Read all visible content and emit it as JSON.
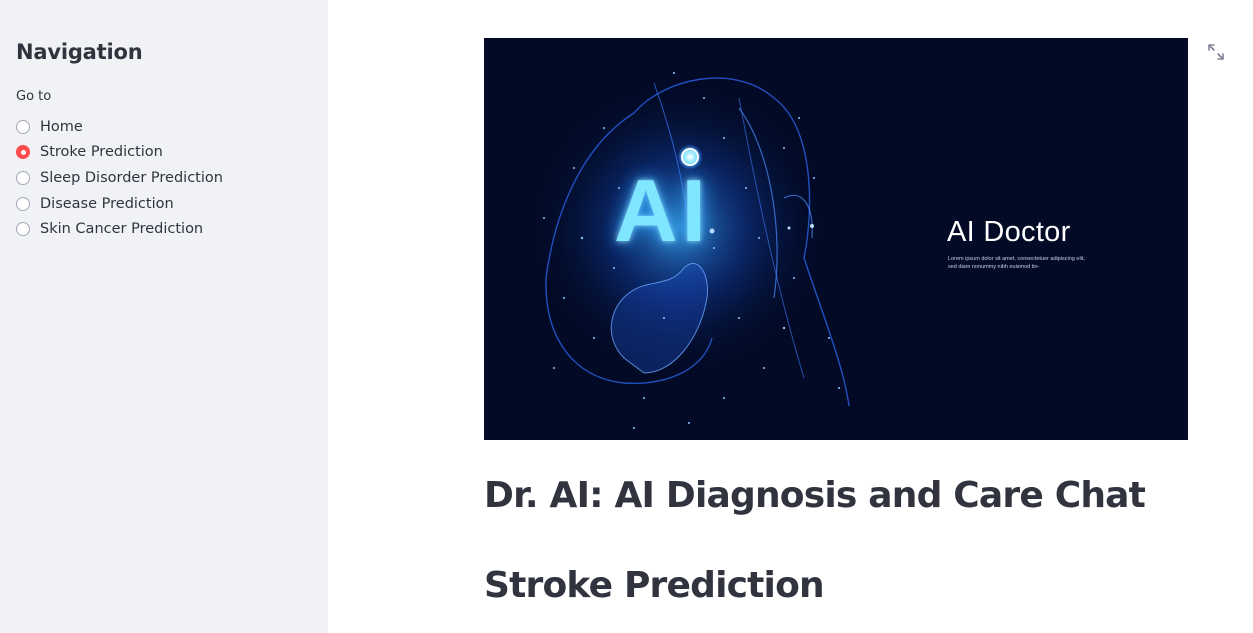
{
  "sidebar": {
    "title": "Navigation",
    "radio_label": "Go to",
    "options": [
      {
        "label": "Home",
        "selected": false
      },
      {
        "label": "Stroke Prediction",
        "selected": true
      },
      {
        "label": "Sleep Disorder Prediction",
        "selected": false
      },
      {
        "label": "Disease Prediction",
        "selected": false
      },
      {
        "label": "Skin Cancer Prediction",
        "selected": false
      }
    ]
  },
  "main": {
    "hero_image": {
      "big_text": "AI",
      "title": "AI Doctor",
      "subtitle": "Lorem ipsum dolor sit amet, consectetuer adipiscing elit, sed diam nonummy nibh euismod tin-"
    },
    "heading": "Dr. AI: AI Diagnosis and Care Chat",
    "subheading": "Stroke Prediction"
  },
  "colors": {
    "sidebar_bg": "#f0f2f6",
    "accent": "#ff4b4b",
    "text": "#31333f",
    "hero_bg": "#020a26"
  },
  "icons": {
    "expand": "fullscreen-expand-icon"
  }
}
